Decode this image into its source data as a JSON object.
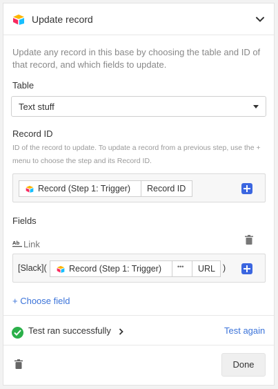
{
  "header": {
    "title": "Update record",
    "logo_icon": "airtable-logo-icon",
    "toggle_icon": "chevron-down-icon"
  },
  "description": "Update any record in this base by choosing the table and ID of that record, and which fields to update.",
  "table": {
    "label": "Table",
    "selected": "Text stuff"
  },
  "record_id": {
    "label": "Record ID",
    "help": "ID of the record to update. To update a record from a previous step, use the + menu to choose the step and its Record ID.",
    "token_source": "Record (Step 1: Trigger)",
    "token_field": "Record ID"
  },
  "fields": {
    "label": "Fields",
    "field_name": "Link",
    "field_type_icon": "text-type-icon",
    "value_prefix": "[Slack](",
    "token_source": "Record (Step 1: Trigger)",
    "token_more": "•••",
    "token_field": "URL",
    "value_suffix": ")"
  },
  "choose_field": "+ Choose field",
  "test": {
    "status": "Test ran successfully",
    "again": "Test again"
  },
  "footer": {
    "done": "Done"
  },
  "colors": {
    "accent": "#3b66e0",
    "success": "#2bb04a",
    "link": "#3b73d9"
  }
}
